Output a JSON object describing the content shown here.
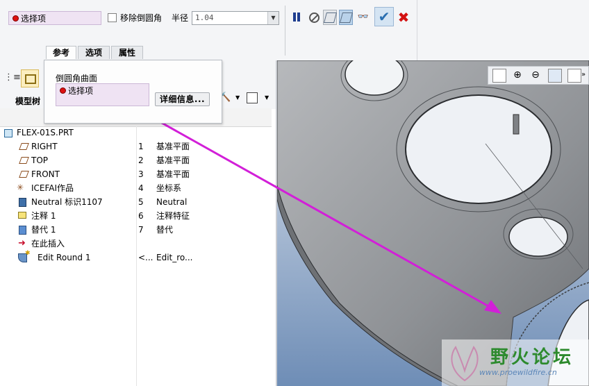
{
  "dashboard": {
    "collector_label": "选择项",
    "remove_round_label": "移除倒圆角",
    "radius_label": "半径",
    "radius_value": "1.04",
    "tabs": [
      "参考",
      "选项",
      "属性"
    ]
  },
  "popup": {
    "section_label": "倒圆角曲面",
    "collector_label": "选择项",
    "details_button": "详细信息..."
  },
  "model_tree": {
    "header": "模型树",
    "root": "FLEX-01S.PRT",
    "items": [
      {
        "name": "RIGHT",
        "id": "1",
        "type": "基准平面",
        "icon": "datum-plane-icon"
      },
      {
        "name": "TOP",
        "id": "2",
        "type": "基准平面",
        "icon": "datum-plane-icon"
      },
      {
        "name": "FRONT",
        "id": "3",
        "type": "基准平面",
        "icon": "datum-plane-icon"
      },
      {
        "name": "ICEFAI作品",
        "id": "4",
        "type": "坐标系",
        "icon": "coordinate-system-icon"
      },
      {
        "name": "Neutral 标识1107",
        "id": "5",
        "type": "Neutral",
        "icon": "neutral-part-icon"
      },
      {
        "name": "注释 1",
        "id": "6",
        "type": "注释特征",
        "icon": "annotation-icon"
      },
      {
        "name": "替代 1",
        "id": "7",
        "type": "替代",
        "icon": "substitute-icon"
      },
      {
        "name": "在此插入",
        "id": "",
        "type": "",
        "icon": "insert-here-arrow-icon"
      },
      {
        "name": "Edit Round 1",
        "id": "<...",
        "type": "Edit_ro...",
        "icon": "edit-round-icon"
      }
    ]
  },
  "watermark": {
    "text": "野火论坛",
    "url": "www.proewildfire.cn"
  },
  "colors": {
    "arrow": "#d21fd8",
    "collector_bg": "#efe3f3",
    "cancel": "#d31111",
    "ok": "#2a6fb0"
  }
}
